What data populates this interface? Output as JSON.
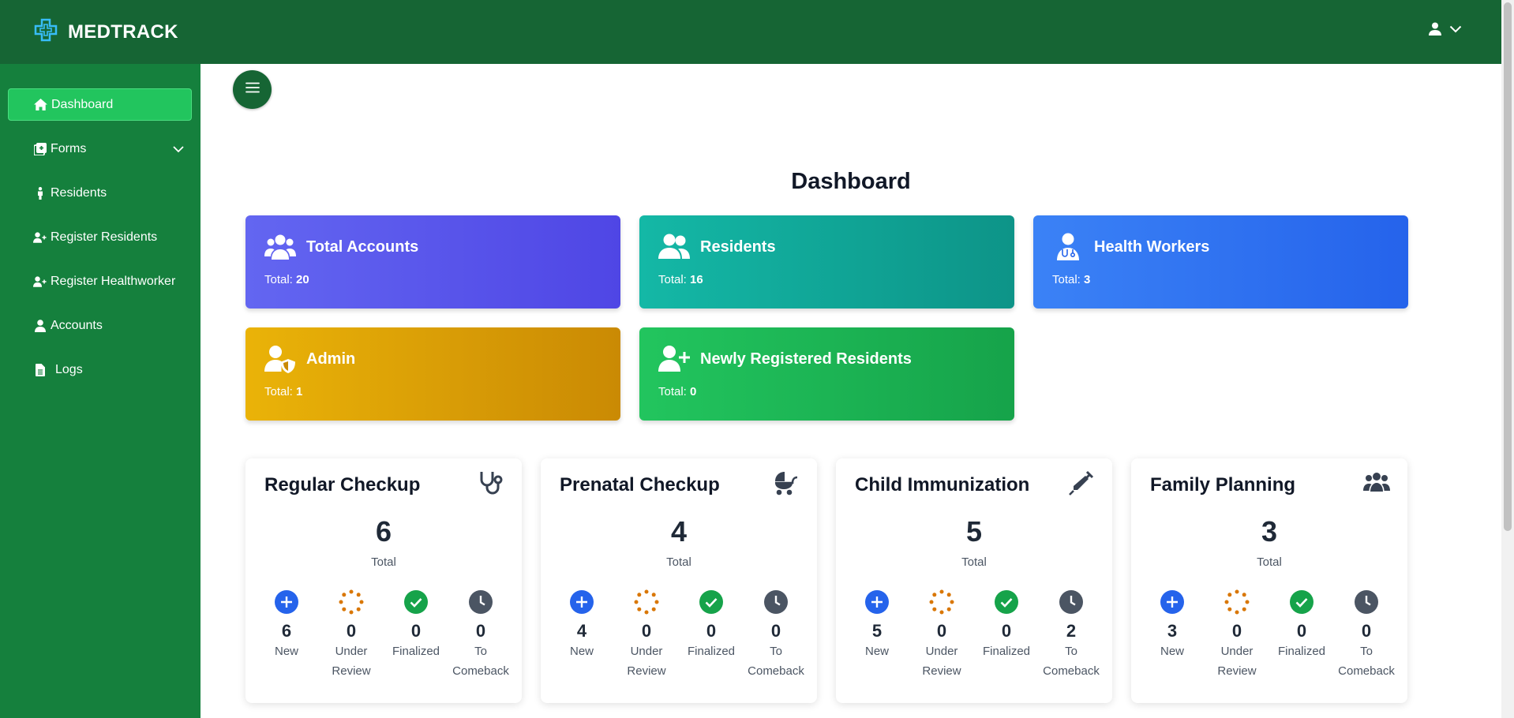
{
  "app": {
    "name": "MEDTRACK"
  },
  "colors": {
    "topbar": "#166534",
    "sidebar": "#15803d",
    "active_item": "#22c55e",
    "purple": "#4f46e5",
    "teal": "#0d9488",
    "blue": "#2563eb",
    "amber": "#ca8a04",
    "green": "#16a34a",
    "status_new": "#2563eb",
    "status_review": "#d97706",
    "status_finalized": "#16a34a",
    "status_comeback": "#4b5563"
  },
  "user_menu": {
    "icon": "user-icon",
    "chevron": "chevron-down-icon"
  },
  "sidebar": {
    "items": [
      {
        "label": "Dashboard",
        "icon": "home-icon",
        "active": true
      },
      {
        "label": "Forms",
        "icon": "forms-icon",
        "has_submenu": true
      },
      {
        "label": "Residents",
        "icon": "person-icon"
      },
      {
        "label": "Register Residents",
        "icon": "user-plus-icon"
      },
      {
        "label": "Register Healthworker",
        "icon": "user-plus-icon"
      },
      {
        "label": "Accounts",
        "icon": "user-icon"
      },
      {
        "label": "Logs",
        "icon": "file-icon"
      }
    ]
  },
  "main": {
    "title": "Dashboard",
    "stat_cards": [
      {
        "title": "Total Accounts",
        "total_label": "Total:",
        "total": "20",
        "icon": "users-icon"
      },
      {
        "title": "Residents",
        "total_label": "Total:",
        "total": "16",
        "icon": "user-group-icon"
      },
      {
        "title": "Health Workers",
        "total_label": "Total:",
        "total": "3",
        "icon": "doctor-icon"
      },
      {
        "title": "Admin",
        "total_label": "Total:",
        "total": "1",
        "icon": "user-shield-icon"
      },
      {
        "title": "Newly Registered Residents",
        "total_label": "Total:",
        "total": "0",
        "icon": "user-plus-icon"
      }
    ],
    "services": [
      {
        "title": "Regular Checkup",
        "icon": "stethoscope-icon",
        "total": "6",
        "total_label": "Total",
        "stats": [
          {
            "count": "6",
            "label": "New"
          },
          {
            "count": "0",
            "label": "Under Review"
          },
          {
            "count": "0",
            "label": "Finalized"
          },
          {
            "count": "0",
            "label": "To Comeback"
          }
        ]
      },
      {
        "title": "Prenatal Checkup",
        "icon": "baby-carriage-icon",
        "total": "4",
        "total_label": "Total",
        "stats": [
          {
            "count": "4",
            "label": "New"
          },
          {
            "count": "0",
            "label": "Under Review"
          },
          {
            "count": "0",
            "label": "Finalized"
          },
          {
            "count": "0",
            "label": "To Comeback"
          }
        ]
      },
      {
        "title": "Child Immunization",
        "icon": "syringe-icon",
        "total": "5",
        "total_label": "Total",
        "stats": [
          {
            "count": "5",
            "label": "New"
          },
          {
            "count": "0",
            "label": "Under Review"
          },
          {
            "count": "0",
            "label": "Finalized"
          },
          {
            "count": "2",
            "label": "To Comeback"
          }
        ]
      },
      {
        "title": "Family Planning",
        "icon": "people-group-icon",
        "total": "3",
        "total_label": "Total",
        "stats": [
          {
            "count": "3",
            "label": "New"
          },
          {
            "count": "0",
            "label": "Under Review"
          },
          {
            "count": "0",
            "label": "Finalized"
          },
          {
            "count": "0",
            "label": "To Comeback"
          }
        ]
      }
    ]
  }
}
